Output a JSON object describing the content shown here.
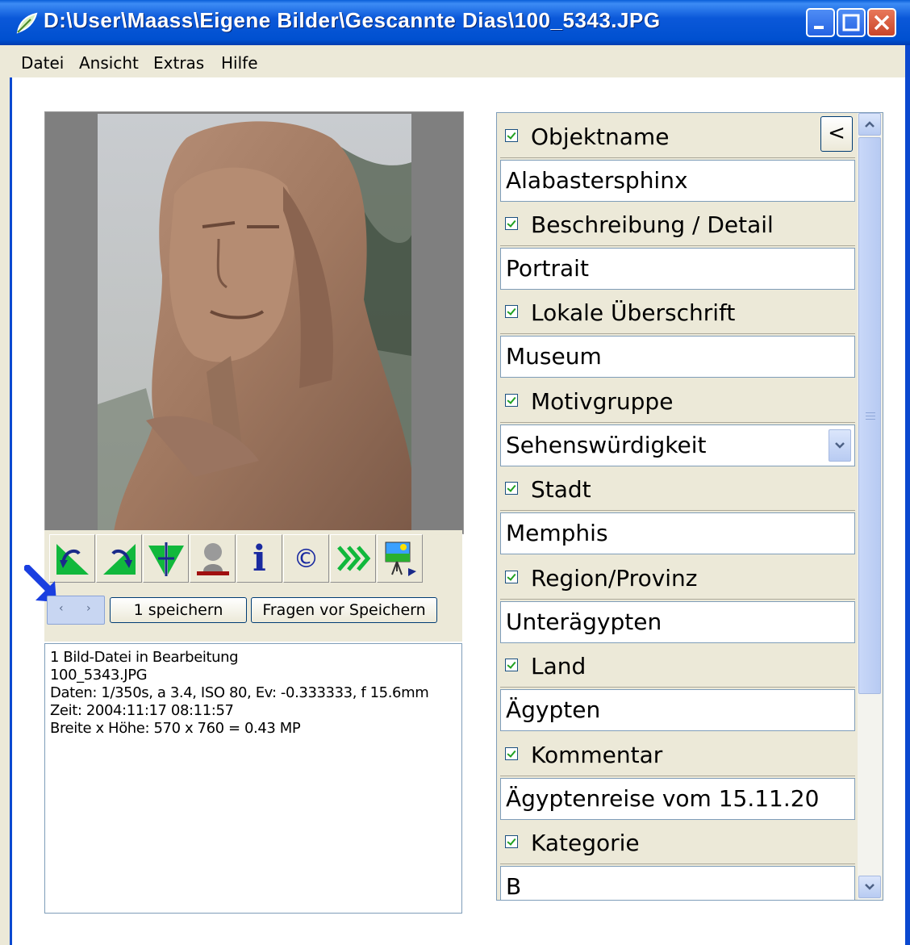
{
  "window": {
    "title": "D:\\User\\Maass\\Eigene Bilder\\Gescannte Dias\\100_5343.JPG"
  },
  "menu": {
    "items": [
      "Datei",
      "Ansicht",
      "Extras",
      "Hilfe"
    ]
  },
  "toolbar": {
    "icons": [
      "rotate-left-icon",
      "rotate-right-icon",
      "flip-horizontal-icon",
      "person-icon",
      "info-icon",
      "copyright-icon",
      "fast-forward-icon",
      "slideshow-icon"
    ],
    "info_glyph": "i",
    "copyright_glyph": "©"
  },
  "actions": {
    "nav_prev": "‹",
    "nav_next": "›",
    "save_label": "1 speichern",
    "ask_label": "Fragen vor Speichern"
  },
  "info": {
    "lines": [
      "1 Bild-Datei in Bearbeitung",
      "100_5343.JPG",
      "Daten: 1/350s, a 3.4, ISO 80, Ev: -0.333333, f 15.6mm",
      "Zeit: 2004:11:17 08:11:57",
      "Breite x Höhe: 570 x 760 = 0.43 MP"
    ]
  },
  "fields": [
    {
      "label": "Objektname",
      "value": "Alabastersphinx",
      "checked": true
    },
    {
      "label": "Beschreibung / Detail",
      "value": "Portrait",
      "checked": true
    },
    {
      "label": "Lokale Überschrift",
      "value": "Museum",
      "checked": true
    },
    {
      "label": "Motivgruppe",
      "value": "Sehenswürdigkeit",
      "checked": true,
      "combo": true
    },
    {
      "label": "Stadt",
      "value": "Memphis",
      "checked": true
    },
    {
      "label": "Region/Provinz",
      "value": "Unterägypten",
      "checked": true
    },
    {
      "label": "Land",
      "value": "Ägypten",
      "checked": true
    },
    {
      "label": "Kommentar",
      "value": "Ägyptenreise vom 15.11.20",
      "checked": true
    },
    {
      "label": "Kategorie",
      "value": "B",
      "checked": true
    }
  ],
  "panel": {
    "collapse_label": "<"
  },
  "colors": {
    "titlebar": "#0054e3",
    "face": "#ece9d8",
    "annotation_arrow": "#1a3fe0"
  }
}
